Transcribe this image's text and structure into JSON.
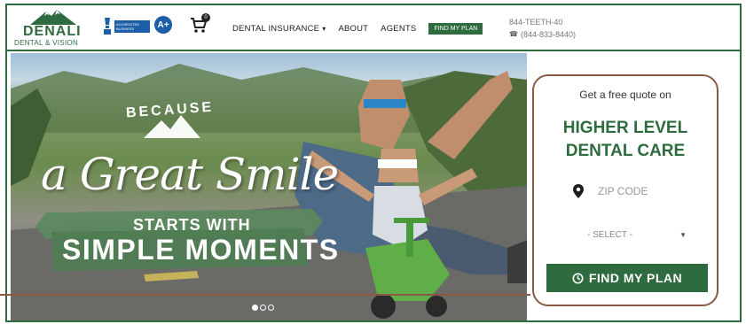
{
  "brand": {
    "name": "DENALI",
    "tagline": "DENTAL & VISION",
    "primary_color": "#2e6b3e",
    "accent_color": "#8a5a45"
  },
  "badges": {
    "bbb_text": "ACCREDITED BUSINESS",
    "rating": "A+",
    "cart_count": "0"
  },
  "nav": {
    "items": [
      {
        "label": "DENTAL INSURANCE",
        "has_dropdown": true
      },
      {
        "label": "ABOUT"
      },
      {
        "label": "AGENTS"
      }
    ],
    "cta_label": "FIND MY PLAN"
  },
  "contact": {
    "phone_vanity": "844-TEETH-40",
    "phone_number": "(844-833-8440)"
  },
  "hero": {
    "line_because": "BECAUSE",
    "line_great": "a Great Smile",
    "line_starts": "STARTS WITH",
    "line_simple": "SIMPLE MOMENTS",
    "slides": 3,
    "active_slide": 1
  },
  "quote": {
    "intro": "Get a free quote on",
    "title_line1": "HIGHER LEVEL",
    "title_line2": "DENTAL CARE",
    "zip_placeholder": "ZIP CODE",
    "select_label": "- SELECT -",
    "button_label": "FIND MY PLAN"
  },
  "icons": {
    "cart": "cart-icon",
    "pin": "map-pin-icon",
    "clock": "clock-icon",
    "chevron": "chevron-down-icon",
    "phone": "phone-icon"
  }
}
